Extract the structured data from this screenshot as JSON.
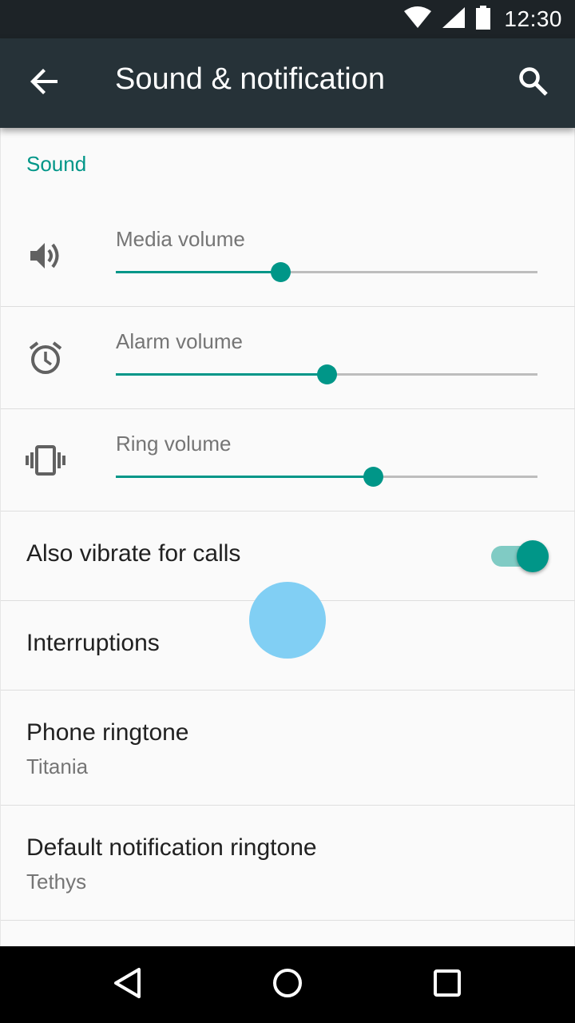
{
  "status_bar": {
    "time": "12:30",
    "icons": [
      "wifi-icon",
      "cell-signal-icon",
      "battery-icon"
    ]
  },
  "app_bar": {
    "title": "Sound & notification",
    "back_icon": "arrow-back-icon",
    "search_icon": "search-icon"
  },
  "sections": {
    "sound_header": "Sound"
  },
  "sliders": [
    {
      "label": "Media volume",
      "icon": "volume-icon",
      "level_percent": 39
    },
    {
      "label": "Alarm volume",
      "icon": "alarm-clock-icon",
      "level_percent": 50
    },
    {
      "label": "Ring volume",
      "icon": "vibrate-icon",
      "level_percent": 61
    }
  ],
  "preferences": {
    "vibrate": {
      "title": "Also vibrate for calls",
      "enabled": true
    },
    "interruptions": {
      "title": "Interruptions"
    },
    "phone_ringtone": {
      "title": "Phone ringtone",
      "summary": "Titania"
    },
    "notification_ringtone": {
      "title": "Default notification ringtone",
      "summary": "Tethys"
    }
  },
  "nav_bar": {
    "buttons": [
      "back-triangle-icon",
      "home-circle-icon",
      "recents-square-icon"
    ]
  },
  "colors": {
    "accent": "#009688",
    "accent_light": "#80cbc4",
    "app_bar": "#263238",
    "status_bar": "#1d2327",
    "touch_indicator": "#81cff4"
  }
}
